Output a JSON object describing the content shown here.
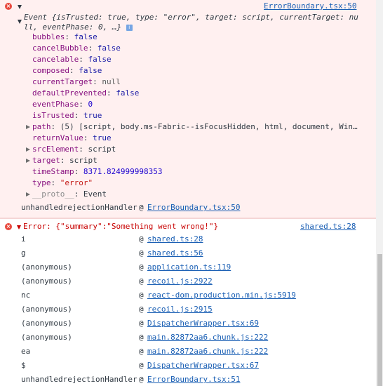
{
  "message1": {
    "source": "ErrorBoundary.tsx:50",
    "summary_line1": "Event {isTrusted: true, type: \"error\", target: script, currentTarget: nu",
    "summary_line2": "ll, eventPhase: 0, …}",
    "info_badge": "i",
    "props": [
      {
        "key": "bubbles",
        "value": "false"
      },
      {
        "key": "cancelBubble",
        "value": "false"
      },
      {
        "key": "cancelable",
        "value": "false"
      },
      {
        "key": "composed",
        "value": "false"
      },
      {
        "key": "currentTarget",
        "value": "null"
      },
      {
        "key": "defaultPrevented",
        "value": "false"
      },
      {
        "key": "eventPhase",
        "value": "0"
      },
      {
        "key": "isTrusted",
        "value": "true"
      },
      {
        "key": "path",
        "value": "(5) [script, body.ms-Fabric--isFocusHidden, html, document, Win…"
      },
      {
        "key": "returnValue",
        "value": "true"
      },
      {
        "key": "srcElement",
        "value": "script"
      },
      {
        "key": "target",
        "value": "script"
      },
      {
        "key": "timeStamp",
        "value": "8371.824999998353"
      },
      {
        "key": "type",
        "value": "\"error\""
      },
      {
        "key": "__proto__",
        "value": "Event"
      }
    ],
    "handler_label": "unhandledrejectionHandler",
    "handler_at": "@",
    "handler_link": "ErrorBoundary.tsx:50"
  },
  "message2": {
    "error_text": "Error: {\"summary\":\"Something went wrong!\"}",
    "source": "shared.ts:28",
    "stack": [
      {
        "fn": "i",
        "link": "shared.ts:28"
      },
      {
        "fn": "g",
        "link": "shared.ts:56"
      },
      {
        "fn": "(anonymous)",
        "link": "application.ts:119"
      },
      {
        "fn": "(anonymous)",
        "link": "recoil.js:2922"
      },
      {
        "fn": "nc",
        "link": "react-dom.production.min.js:5919"
      },
      {
        "fn": "(anonymous)",
        "link": "recoil.js:2915"
      },
      {
        "fn": "(anonymous)",
        "link": "DispatcherWrapper.tsx:69"
      },
      {
        "fn": "(anonymous)",
        "link": "main.82872aa6.chunk.js:222"
      },
      {
        "fn": "ea",
        "link": "main.82872aa6.chunk.js:222"
      },
      {
        "fn": "$",
        "link": "DispatcherWrapper.tsx:67"
      },
      {
        "fn": "unhandledrejectionHandler",
        "link": "ErrorBoundary.tsx:51"
      }
    ],
    "at": "@"
  },
  "colors": {
    "error_bg": "#fff0f0",
    "error_red": "#c80000",
    "link_blue": "#1a5fb4",
    "key_purple": "#881280",
    "value_blue": "#1a1aa6"
  },
  "icons": {
    "error": "error-circle-icon",
    "expand": "expand-triangle-icon",
    "collapsed": "collapsed-triangle-icon"
  }
}
